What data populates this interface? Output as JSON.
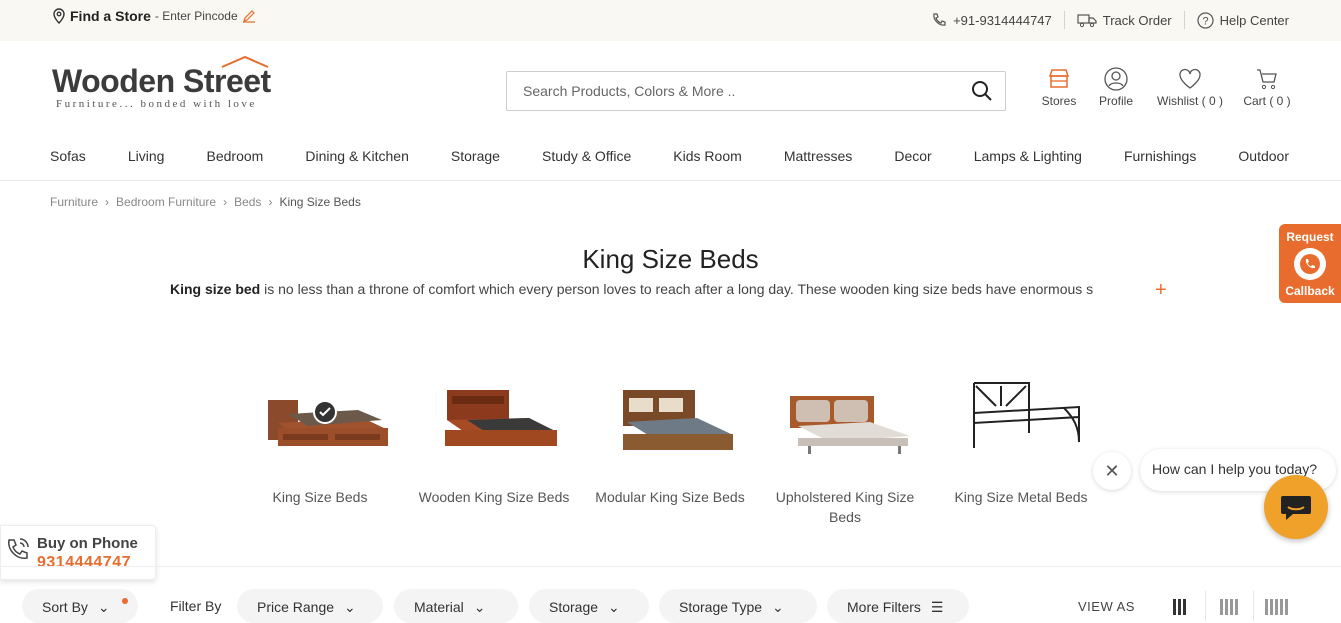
{
  "topbar": {
    "find_store": "Find a Store",
    "pincode": "- Enter Pincode",
    "phone": "+91-9314444747",
    "track_order": "Track Order",
    "help_center": "Help Center"
  },
  "header": {
    "brand": "Wooden Street",
    "tagline": "Furniture... bonded with love",
    "search_placeholder": "Search Products, Colors & More ..",
    "stores": "Stores",
    "profile": "Profile",
    "wishlist": "Wishlist ( 0 )",
    "cart": "Cart ( 0 )"
  },
  "nav": [
    "Sofas",
    "Living",
    "Bedroom",
    "Dining & Kitchen",
    "Storage",
    "Study & Office",
    "Kids Room",
    "Mattresses",
    "Decor",
    "Lamps & Lighting",
    "Furnishings",
    "Outdoor"
  ],
  "breadcrumb": [
    "Furniture",
    "Bedroom Furniture",
    "Beds",
    "King Size Beds"
  ],
  "page": {
    "title": "King Size Beds",
    "desc_bold": "King size bed",
    "desc_rest": " is no less than a throne of comfort which every person loves to reach after a long day. These wooden king size beds have enormous s",
    "plus": "+"
  },
  "categories": [
    {
      "label": "King Size Beds",
      "selected": true
    },
    {
      "label": "Wooden King Size Beds"
    },
    {
      "label": "Modular King Size Beds"
    },
    {
      "label": "Upholstered King Size Beds"
    },
    {
      "label": "King Size Metal Beds"
    }
  ],
  "callback": {
    "top": "Request",
    "bottom": "Callback"
  },
  "chat": {
    "message": "How can I help you today?"
  },
  "buy_phone": {
    "label": "Buy on Phone",
    "number": "9314444747"
  },
  "filters": {
    "sort": "Sort By",
    "filter_by": "Filter By",
    "price": "Price Range",
    "material": "Material",
    "storage": "Storage",
    "storage_type": "Storage Type",
    "more": "More Filters",
    "view_as": "VIEW AS"
  },
  "colors": {
    "accent": "#e86c2d",
    "chat": "#f0a12a"
  }
}
